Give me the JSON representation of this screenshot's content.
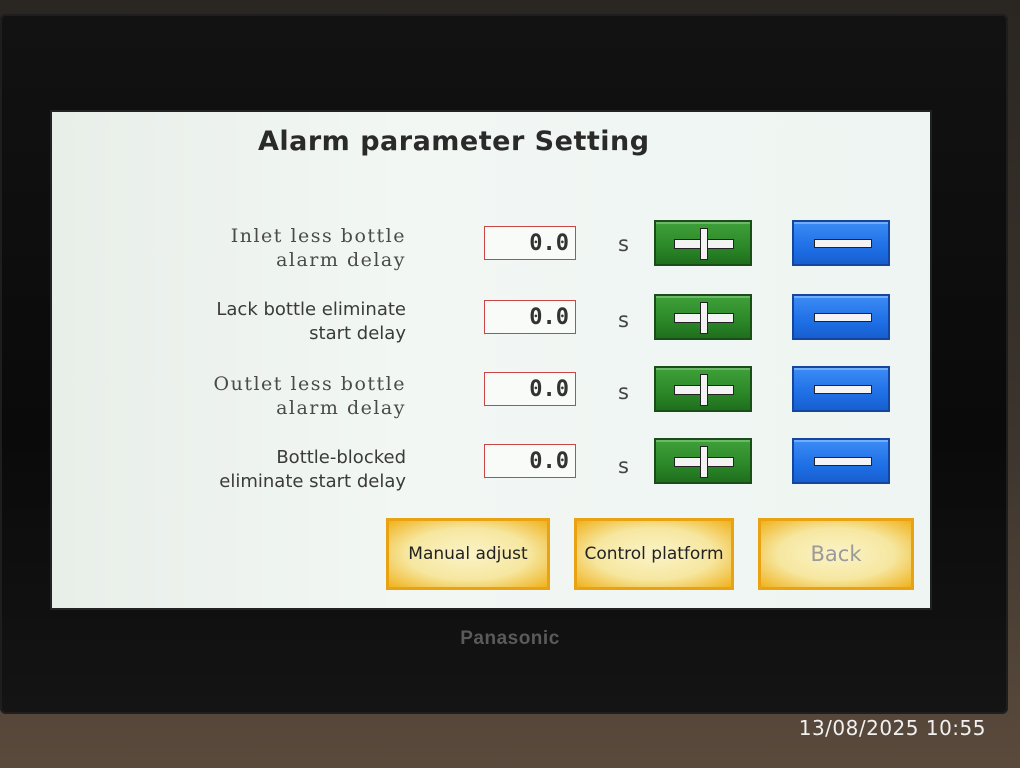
{
  "screen": {
    "title": "Alarm parameter Setting"
  },
  "parameters": [
    {
      "label_lines": [
        "Inlet less bottle",
        "alarm delay"
      ],
      "value": "0.0",
      "unit": "s"
    },
    {
      "label_lines": [
        "Lack bottle eliminate",
        "start delay"
      ],
      "value": "0.0",
      "unit": "s"
    },
    {
      "label_lines": [
        "Outlet less bottle",
        "alarm delay"
      ],
      "value": "0.0",
      "unit": "s"
    },
    {
      "label_lines": [
        "Bottle-blocked",
        "eliminate start delay"
      ],
      "value": "0.0",
      "unit": "s"
    }
  ],
  "buttons": {
    "increment_icon": "plus-icon",
    "decrement_icon": "minus-icon",
    "manual_adjust": "Manual adjust",
    "control_platform": "Control platform",
    "back": "Back"
  },
  "device": {
    "brand": "Panasonic"
  },
  "photo": {
    "timestamp": "13/08/2025 10:55"
  },
  "colors": {
    "increment_button": "#2d8a29",
    "decrement_button": "#1f6fe6",
    "nav_button": "#f0b21e",
    "value_border": "#c84646"
  }
}
